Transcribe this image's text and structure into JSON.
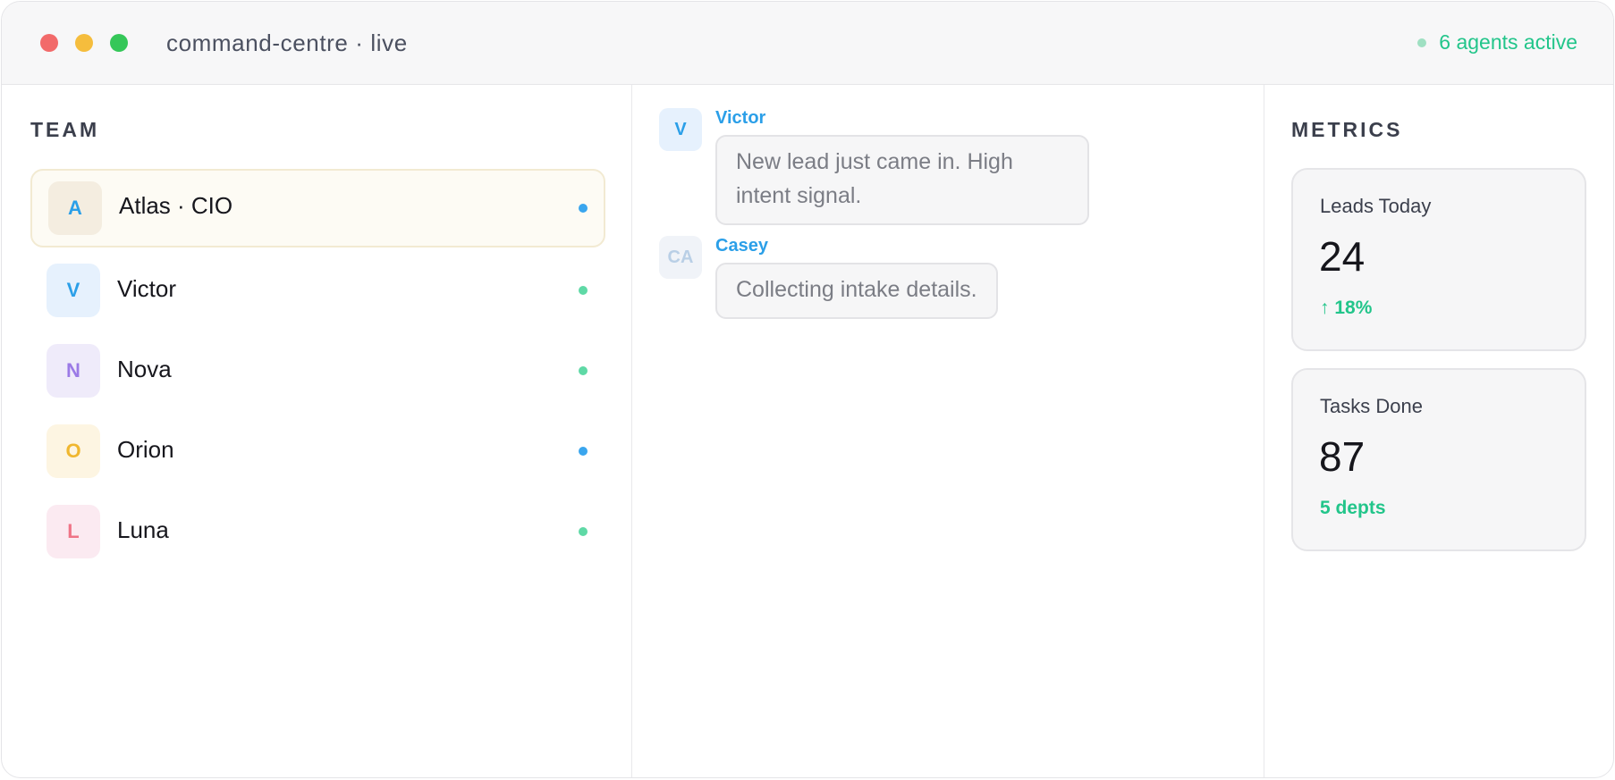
{
  "window": {
    "title": "command-centre · live",
    "status_text": "6 agents active",
    "status_color": "#22c58a"
  },
  "team": {
    "heading": "TEAM",
    "members": [
      {
        "initial": "A",
        "name": "Atlas · CIO",
        "selected": true,
        "avatar_bg": "#f4ede0",
        "avatar_fg": "#2b9fe8",
        "status_color": "#3aa6ee"
      },
      {
        "initial": "V",
        "name": "Victor",
        "selected": false,
        "avatar_bg": "#e6f1fd",
        "avatar_fg": "#2b9fe8",
        "status_color": "#5fd9a6"
      },
      {
        "initial": "N",
        "name": "Nova",
        "selected": false,
        "avatar_bg": "#efebfa",
        "avatar_fg": "#9b7ae6",
        "status_color": "#5fd9a6"
      },
      {
        "initial": "O",
        "name": "Orion",
        "selected": false,
        "avatar_bg": "#fdf5e2",
        "avatar_fg": "#f0b72f",
        "status_color": "#3aa6ee"
      },
      {
        "initial": "L",
        "name": "Luna",
        "selected": false,
        "avatar_bg": "#fbeaf1",
        "avatar_fg": "#ef7487",
        "status_color": "#5fd9a6"
      }
    ]
  },
  "chat": {
    "messages": [
      {
        "initials": "V",
        "author": "Victor",
        "avatar_bg": "#e6f1fd",
        "avatar_fg": "#2b9fe8",
        "text": "New lead just came in. High intent signal."
      },
      {
        "initials": "CA",
        "author": "Casey",
        "avatar_bg": "#f0f3f8",
        "avatar_fg": "#b9cfe6",
        "text": "Collecting intake details."
      }
    ]
  },
  "metrics": {
    "heading": "METRICS",
    "cards": [
      {
        "label": "Leads Today",
        "value": "24",
        "sub": "↑ 18%"
      },
      {
        "label": "Tasks Done",
        "value": "87",
        "sub": "5 depts"
      }
    ]
  }
}
